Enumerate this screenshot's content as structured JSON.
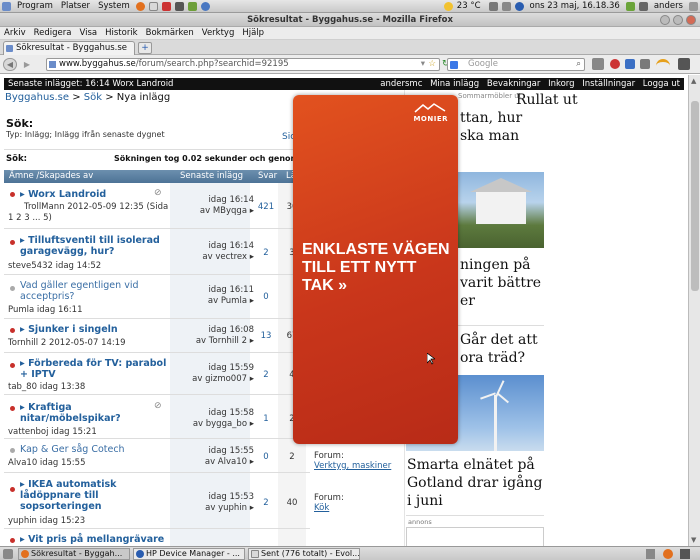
{
  "panel": {
    "menus": [
      "Program",
      "Platser",
      "System"
    ],
    "temperature": "23 °C",
    "datetime": "ons 23 maj, 16.18.36",
    "user": "anders"
  },
  "window": {
    "title": "Sökresultat - Byggahus.se - Mozilla Firefox"
  },
  "menubar": [
    "Arkiv",
    "Redigera",
    "Visa",
    "Historik",
    "Bokmärken",
    "Verktyg",
    "Hjälp"
  ],
  "tab": {
    "title": "Sökresultat - Byggahus.se",
    "new_tab": "+"
  },
  "nav": {
    "url_host": "www.byggahus.se",
    "url_path": "/forum/search.php?searchid=92195",
    "search_engine": "Google",
    "search_placeholder": "Google"
  },
  "site": {
    "latest": "Senaste inlägget: 16:14 Worx Landroid",
    "user_links": [
      "andersmc",
      "Mina inlägg",
      "Bevakningar",
      "Inkorg",
      "Inställningar",
      "Logga ut"
    ],
    "breadcrumb": {
      "home": "Byggahus.se",
      "sep": " > ",
      "search": "Sök",
      "current": "Nya inlägg"
    }
  },
  "search": {
    "heading": "Sök:",
    "subtitle": "Typ: Inlägg; Inlägg ifrån senaste dygnet",
    "side_link": "Sic",
    "label": "Sök:",
    "timing": "Sökningen tog 0.02 sekunder och genomförd"
  },
  "table": {
    "headers": {
      "topic": "Ämne /Skapades av",
      "last": "Senaste inlägg",
      "replies": "Svar",
      "read": "Lä"
    },
    "rows": [
      {
        "title": "▸ Worx Landroid",
        "meta": "TrollMann 2012-05-09 12:35  (Sida",
        "pages": "1 2 3 ... 5)",
        "last1": "idag 16:14",
        "last2": "av MByqga ▸",
        "replies": "421",
        "read": "36",
        "state": "new"
      },
      {
        "title": "▸ Tilluftsventil till isolerad garagevägg, hur?",
        "meta": "steve5432 idag 14:52",
        "last1": "idag 16:14",
        "last2": "av vectrex ▸",
        "replies": "2",
        "read": "3",
        "state": "new"
      },
      {
        "title": "Vad gäller egentligen vid acceptpris?",
        "meta": "Pumla idag 16:11",
        "last1": "idag 16:11",
        "last2": "av Pumla ▸",
        "replies": "0",
        "read": "",
        "state": "read"
      },
      {
        "title": "▸ Sjunker i singeln",
        "meta": "Tornhill 2 2012-05-07 14:19",
        "last1": "idag 16:08",
        "last2": "av Tornhill 2 ▸",
        "replies": "13",
        "read": "67",
        "state": "new"
      },
      {
        "title": "▸ Förbereda för TV: parabol + IPTV",
        "meta": "tab_80 idag 13:38",
        "last1": "idag 15:59",
        "last2": "av gizmo007 ▸",
        "replies": "2",
        "read": "4",
        "state": "new"
      },
      {
        "title": "▸ Kraftiga nitar/möbelspikar?",
        "meta": "vattenboj idag 15:21",
        "last1": "idag 15:58",
        "last2": "av bygga_bo ▸",
        "replies": "1",
        "read": "2",
        "state": "new"
      },
      {
        "title": "Kap & Ger såg Cotech",
        "meta": "Alva10 idag 15:55",
        "last1": "idag 15:55",
        "last2": "av Alva10 ▸",
        "replies": "0",
        "read": "2",
        "state": "read"
      },
      {
        "title": "▸ IKEA automatisk lådöppnare till sopsorteringen",
        "meta": "yuphin idag 15:23",
        "last1": "idag 15:53",
        "last2": "av yuphin ▸",
        "replies": "2",
        "read": "40",
        "state": "new"
      },
      {
        "title": "▸ Vit pris på mellangrävare +",
        "meta": "",
        "last1": "",
        "last2": "",
        "replies": "",
        "read": "",
        "state": "new"
      }
    ],
    "forum_label_1": "Forum:",
    "forum_value_1": "Verktyg, maskiner",
    "forum_label_2": "Forum:",
    "forum_value_2": "Kök"
  },
  "ad": {
    "brand": "MONIER",
    "slogan": "ENKLASTE VÄGEN TILL ETT NYTT TAK »"
  },
  "news": {
    "top_partial": "Rullat ut",
    "top_line2": "ttan, hur",
    "top_line3": "ska man",
    "small_caption": "Sommarmöbler ut",
    "story2_l1": "ningen på",
    "story2_l2": "varit bättre",
    "story2_l3": "er",
    "story3_l1": "Går det att",
    "story3_l2": "ora träd?",
    "story4": "Smarta elnätet på Gotland drar igång i juni",
    "ad_label": "annons"
  },
  "taskbar": {
    "items": [
      "Sökresultat - Byggah...",
      "HP Device Manager - ...",
      "Sent (776 totalt) - Evol..."
    ]
  }
}
